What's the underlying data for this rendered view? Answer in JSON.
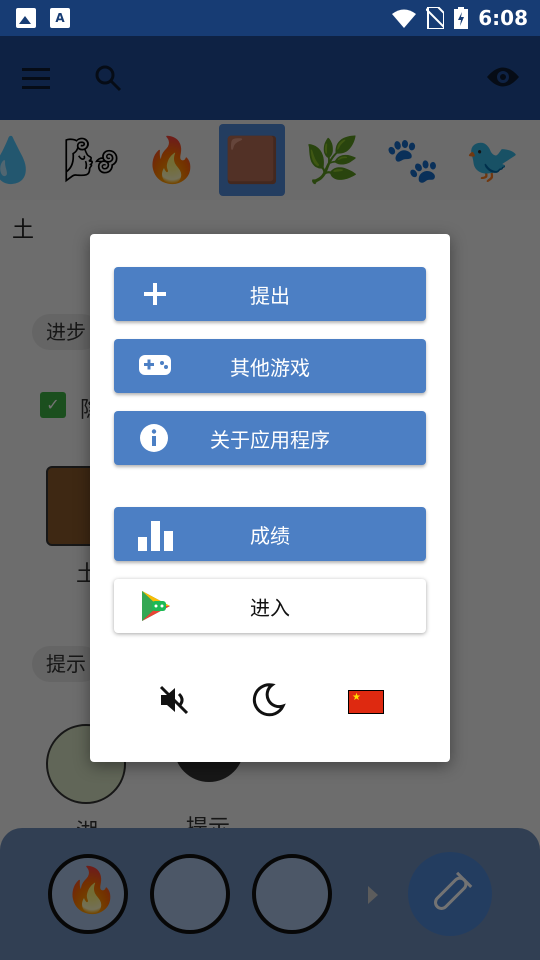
{
  "status_bar": {
    "time": "6:08"
  },
  "section_title": "土",
  "background": {
    "chip_progress": "进步",
    "checkbox_label": "隐",
    "element_label": "土",
    "chip_hints": "提示",
    "bottom_label_1": "湖",
    "bottom_label_2": "提示"
  },
  "dialog": {
    "submit_label": "提出",
    "other_games_label": "其他游戏",
    "about_label": "关于应用程序",
    "achievements_label": "成绩",
    "sign_in_label": "进入"
  },
  "icons": {
    "submit": "plus-icon",
    "other_games": "gamepad-icon",
    "about": "info-icon",
    "achievements": "bar-chart-icon",
    "sign_in": "play-games-icon",
    "mute": "mute-icon",
    "moon": "moon-icon",
    "flag": "china-flag-icon"
  },
  "colors": {
    "app_bar": "#1f4d97",
    "button_blue": "#4c7fc4",
    "selected_element": "#4f87d6"
  }
}
